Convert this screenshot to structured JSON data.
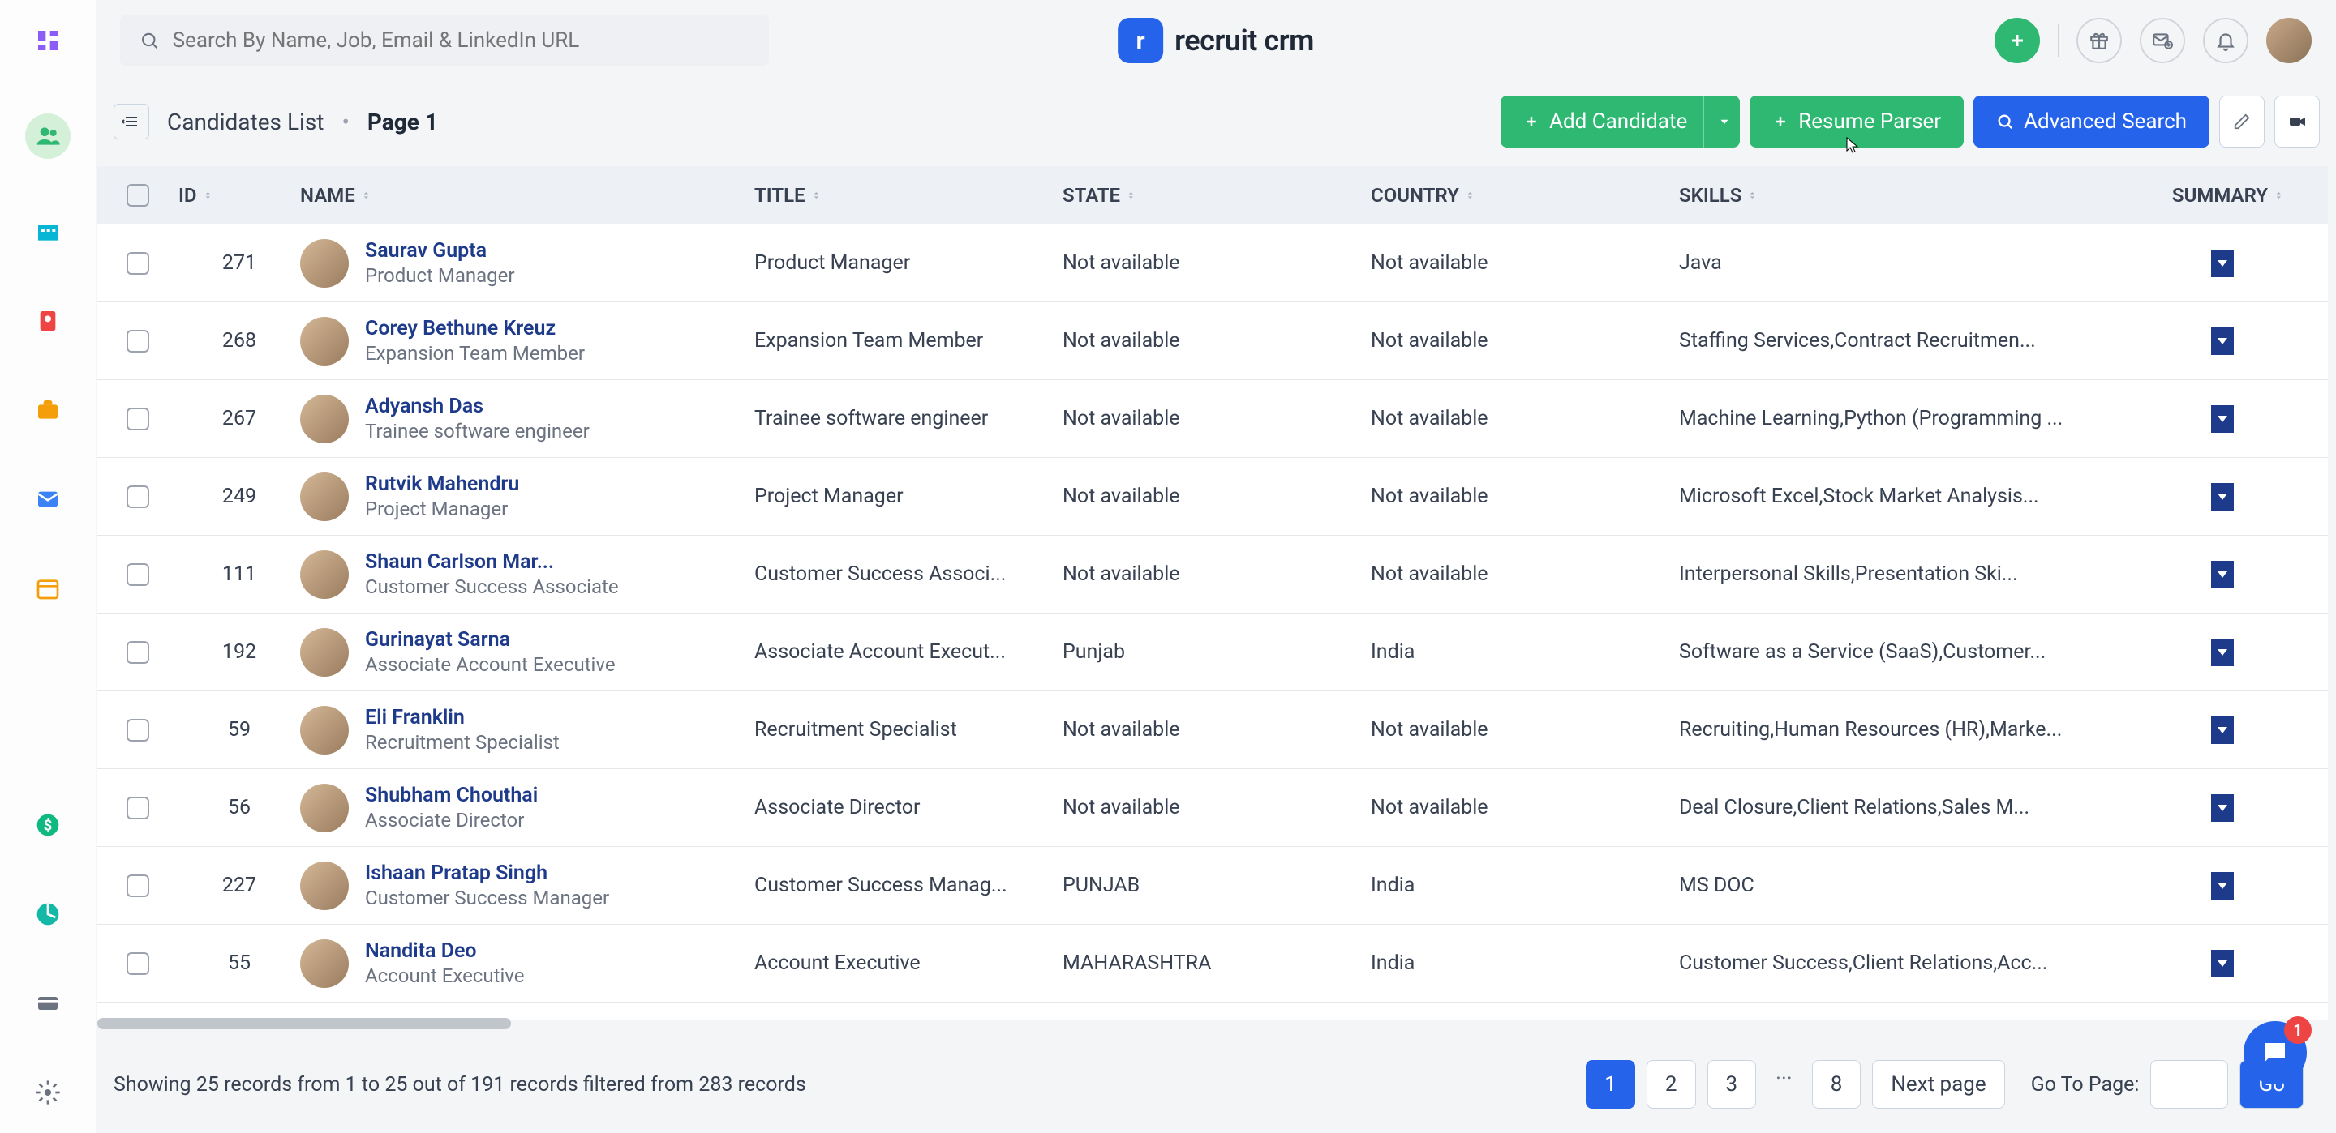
{
  "search": {
    "placeholder": "Search By Name, Job, Email & LinkedIn URL"
  },
  "brand": {
    "name": "recruit crm",
    "badge": "r"
  },
  "header": {
    "title": "Candidates List",
    "page_label": "Page 1",
    "add_candidate": "Add Candidate",
    "resume_parser": "Resume Parser",
    "advanced_search": "Advanced Search"
  },
  "columns": {
    "id": "ID",
    "name": "NAME",
    "title": "TITLE",
    "state": "STATE",
    "country": "COUNTRY",
    "skills": "SKILLS",
    "summary": "SUMMARY"
  },
  "rows": [
    {
      "id": "271",
      "name": "Saurav Gupta",
      "sub": "Product Manager",
      "title": "Product Manager",
      "state": "Not available",
      "country": "Not available",
      "skills": "Java"
    },
    {
      "id": "268",
      "name": "Corey Bethune Kreuz",
      "sub": "Expansion Team Member",
      "title": "Expansion Team Member",
      "state": "Not available",
      "country": "Not available",
      "skills": "Staffing Services,Contract Recruitmen..."
    },
    {
      "id": "267",
      "name": "Adyansh Das",
      "sub": "Trainee software engineer",
      "title": "Trainee software engineer",
      "state": "Not available",
      "country": "Not available",
      "skills": "Machine Learning,Python (Programming ..."
    },
    {
      "id": "249",
      "name": "Rutvik Mahendru",
      "sub": "Project Manager",
      "title": "Project Manager",
      "state": "Not available",
      "country": "Not available",
      "skills": "Microsoft Excel,Stock Market Analysis..."
    },
    {
      "id": "111",
      "name": "Shaun Carlson Mar...",
      "sub": "Customer Success Associate",
      "title": "Customer Success Associ...",
      "state": "Not available",
      "country": "Not available",
      "skills": "Interpersonal Skills,Presentation Ski..."
    },
    {
      "id": "192",
      "name": "Gurinayat Sarna",
      "sub": "Associate Account Executive",
      "title": "Associate Account Execut...",
      "state": "Punjab",
      "country": "India",
      "skills": "Software as a Service (SaaS),Customer..."
    },
    {
      "id": "59",
      "name": "Eli Franklin",
      "sub": "Recruitment Specialist",
      "title": "Recruitment Specialist",
      "state": "Not available",
      "country": "Not available",
      "skills": "Recruiting,Human Resources (HR),Marke..."
    },
    {
      "id": "56",
      "name": "Shubham Chouthai",
      "sub": "Associate Director",
      "title": "Associate Director",
      "state": "Not available",
      "country": "Not available",
      "skills": "Deal Closure,Client Relations,Sales M..."
    },
    {
      "id": "227",
      "name": "Ishaan Pratap Singh",
      "sub": "Customer Success Manager",
      "title": "Customer Success Manag...",
      "state": "PUNJAB",
      "country": "India",
      "skills": "MS DOC"
    },
    {
      "id": "55",
      "name": "Nandita Deo",
      "sub": "Account Executive",
      "title": "Account Executive",
      "state": "MAHARASHTRA",
      "country": "India",
      "skills": "Customer Success,Client Relations,Acc..."
    }
  ],
  "footer": {
    "summary": "Showing 25 records from 1 to 25 out of 191 records filtered from 283 records",
    "pages": [
      "1",
      "2",
      "3",
      "...",
      "8"
    ],
    "next": "Next page",
    "goto_label": "Go To Page:",
    "go": "Go"
  },
  "chat": {
    "badge": "1"
  }
}
